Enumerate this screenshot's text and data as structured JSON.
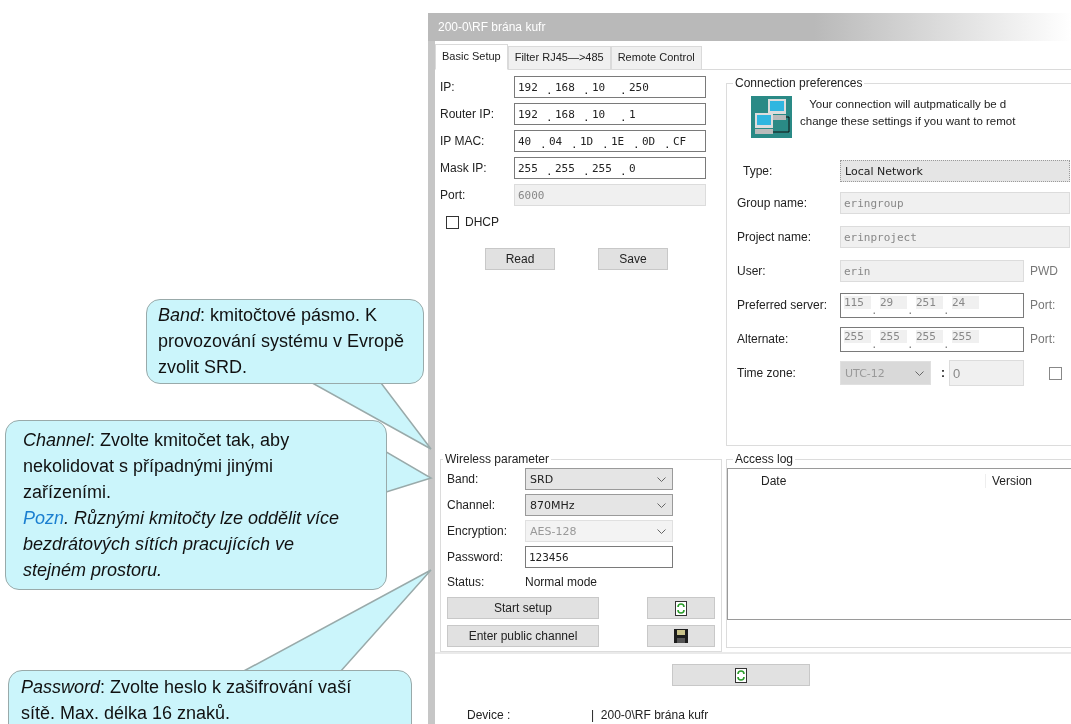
{
  "window": {
    "title": "200-0\\RF brána kufr"
  },
  "tabs": [
    {
      "label": "Basic Setup",
      "selected": true
    },
    {
      "label": "Filter RJ45—>485",
      "selected": false
    },
    {
      "label": "Remote Control",
      "selected": false
    }
  ],
  "network": {
    "fields": [
      {
        "label": "IP:",
        "kind": "ip",
        "separator": ".",
        "octets": [
          "192",
          "168",
          "10",
          "250"
        ]
      },
      {
        "label": "Router IP:",
        "kind": "ip",
        "separator": ".",
        "octets": [
          "192",
          "168",
          "10",
          "1"
        ]
      },
      {
        "label": "IP MAC:",
        "kind": "mac",
        "separator": ".",
        "octets": [
          "40",
          "04",
          "1D",
          "1E",
          "0D",
          "CF"
        ]
      },
      {
        "label": "Mask IP:",
        "kind": "ip",
        "separator": ".",
        "octets": [
          "255",
          "255",
          "255",
          "0"
        ]
      },
      {
        "label": "Port:",
        "kind": "text",
        "value": "6000",
        "disabled": true
      }
    ],
    "dhcp": {
      "label": "DHCP",
      "checked": false
    },
    "buttons": [
      "Read",
      "Save"
    ]
  },
  "wireless": {
    "title": "Wireless parameter",
    "rows": [
      {
        "label": "Band:",
        "kind": "select",
        "value": "SRD",
        "disabled": false
      },
      {
        "label": "Channel:",
        "kind": "select",
        "value": "870MHz",
        "disabled": false
      },
      {
        "label": "Encryption:",
        "kind": "select",
        "value": "AES-128",
        "disabled": true
      },
      {
        "label": "Password:",
        "kind": "input",
        "value": "123456"
      },
      {
        "label": "Status:",
        "kind": "status",
        "value": "Normal mode"
      }
    ],
    "buttons": [
      "Start setup",
      "Enter public channel"
    ]
  },
  "connection": {
    "title": "Connection preferences",
    "message": [
      "Your connection will autpmatically be d",
      "change these settings if you want to remot"
    ],
    "rows": [
      {
        "label": "Type:",
        "kind": "select",
        "value": "Local Network"
      },
      {
        "label": "Group name:",
        "kind": "text",
        "value": "eringroup",
        "disabled": true
      },
      {
        "label": "Project name:",
        "kind": "text",
        "value": "erinproject",
        "disabled": true
      },
      {
        "label": "User:",
        "kind": "text",
        "value": "erin",
        "disabled": true,
        "suffix": "PWD"
      },
      {
        "label": "Preferred server:",
        "kind": "ip",
        "separator": ".",
        "octets": [
          "115",
          "29",
          "251",
          "24"
        ],
        "disabled": true,
        "suffix": "Port:"
      },
      {
        "label": "Alternate:",
        "kind": "ip",
        "separator": ".",
        "octets": [
          "255",
          "255",
          "255",
          "255"
        ],
        "disabled": true,
        "suffix": "Port:"
      },
      {
        "label": "Time zone:",
        "kind": "timezone",
        "value": "UTC-12",
        "separator": ":",
        "minutes": "0",
        "disabled": true,
        "checked": false
      }
    ]
  },
  "access_log": {
    "title": "Access log",
    "columns": [
      "Date",
      "Version"
    ]
  },
  "device": {
    "label": "Device :",
    "value": "|  200-0\\RF brána kufr"
  },
  "callouts": [
    {
      "paragraphs": [
        {
          "text": "*Band*: kmitočtové pásmo. K provozování systému v Evropě zvolit SRD."
        }
      ]
    },
    {
      "paragraphs": [
        {
          "text": "*Channel*: Zvolte kmitočet tak, aby nekolidovat s případnými jinými zařízeními."
        },
        {
          "link": "Pozn",
          "text": ". Různými kmitočty lze oddělit více bezdrátových sítích pracujících ve stejném prostoru."
        }
      ]
    },
    {
      "paragraphs": [
        {
          "text": "*Password*: Zvolte heslo k zašifrování vaší sítě. Max. délka 16 znaků."
        }
      ]
    }
  ]
}
